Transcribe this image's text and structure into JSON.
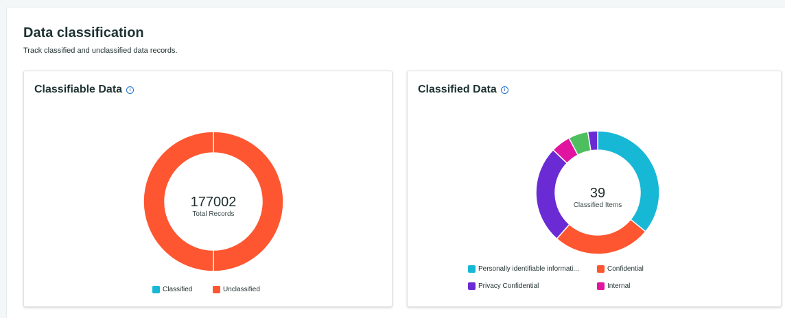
{
  "header": {
    "title": "Data classification",
    "subtitle": "Track classified and unclassified data records."
  },
  "colors": {
    "classified": "#17b8d6",
    "unclassified": "#fe5630",
    "confidential": "#fe5630",
    "privacy_confidential": "#6b2bd4",
    "internal": "#e0149e",
    "green": "#4dbf5f",
    "purple_small": "#6b2bd4",
    "info": "#1c6fd1"
  },
  "cards": [
    {
      "title": "Classifiable Data",
      "info_icon": "info-icon",
      "center_value": "177002",
      "center_label": "Total Records",
      "legend": [
        {
          "label": "Classified",
          "color": "#17b8d6"
        },
        {
          "label": "Unclassified",
          "color": "#fe5630"
        }
      ],
      "chart_data": {
        "type": "pie",
        "categories": [
          "Classified",
          "Unclassified"
        ],
        "values": [
          0,
          177002
        ]
      }
    },
    {
      "title": "Classified Data",
      "info_icon": "info-icon",
      "center_value": "39",
      "center_label": "Classified Items",
      "legend": [
        {
          "label": "Personally identifiable informati...",
          "color": "#17b8d6"
        },
        {
          "label": "Confidential",
          "color": "#fe5630"
        },
        {
          "label": "Privacy Confidential",
          "color": "#6b2bd4"
        },
        {
          "label": "Internal",
          "color": "#e0149e"
        }
      ],
      "chart_data": {
        "type": "pie",
        "segments": [
          {
            "label": "Personally identifiable informati...",
            "value": 14,
            "color": "#17b8d6"
          },
          {
            "label": "Confidential",
            "value": 10,
            "color": "#fe5630"
          },
          {
            "label": "Privacy Confidential",
            "value": 10,
            "color": "#6b2bd4"
          },
          {
            "label": "Internal",
            "value": 2,
            "color": "#e0149e"
          },
          {
            "label": "",
            "value": 2,
            "color": "#4dbf5f"
          },
          {
            "label": "",
            "value": 1,
            "color": "#6b2bd4"
          }
        ]
      }
    }
  ]
}
